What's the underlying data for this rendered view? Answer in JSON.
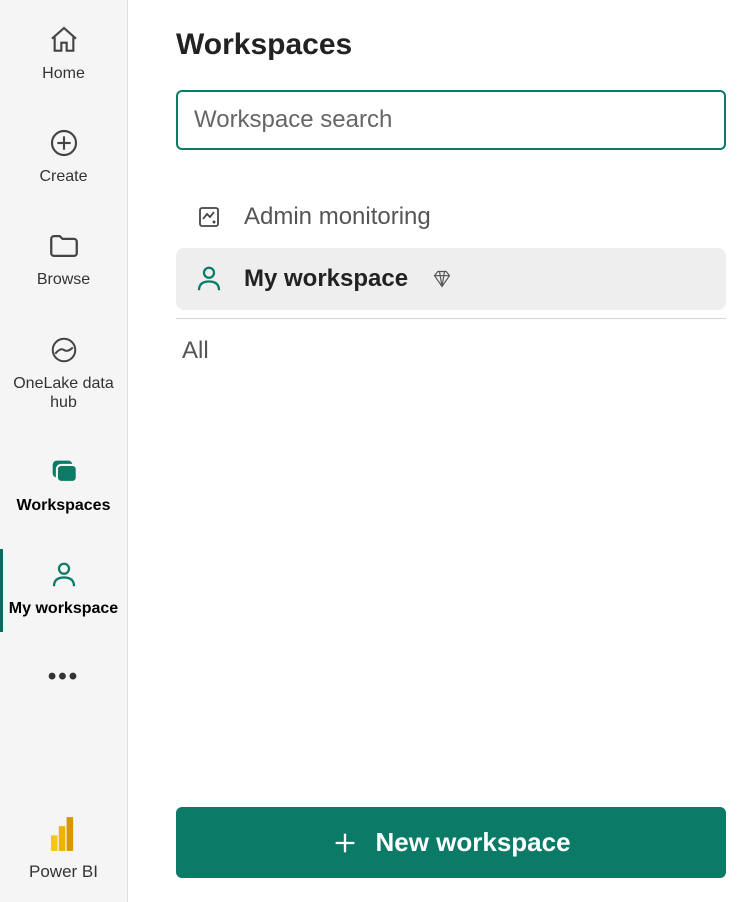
{
  "nav": {
    "items": [
      {
        "label": "Home"
      },
      {
        "label": "Create"
      },
      {
        "label": "Browse"
      },
      {
        "label": "OneLake data hub"
      },
      {
        "label": "Workspaces"
      },
      {
        "label": "My workspace"
      }
    ],
    "footer_label": "Power BI"
  },
  "panel": {
    "title": "Workspaces",
    "search_placeholder": "Workspace search",
    "items": [
      {
        "label": "Admin monitoring"
      },
      {
        "label": "My workspace"
      }
    ],
    "section_label": "All",
    "new_button_label": "New workspace"
  }
}
